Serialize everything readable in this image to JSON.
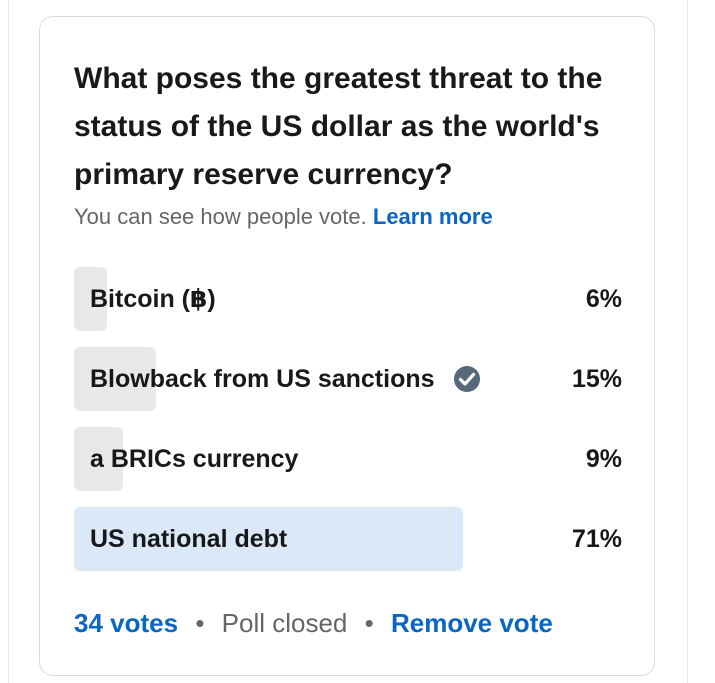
{
  "poll": {
    "question": "What poses the greatest threat to the status of the US dollar as the world's primary reserve currency?",
    "visibility_note": "You can see how people vote.",
    "learn_more": "Learn more",
    "options": [
      {
        "label": "Bitcoin (฿)",
        "percent_label": "6%",
        "percent": 6,
        "selected": false,
        "leading": false
      },
      {
        "label": "Blowback from US sanctions",
        "percent_label": "15%",
        "percent": 15,
        "selected": true,
        "leading": false
      },
      {
        "label": "a BRICs currency",
        "percent_label": "9%",
        "percent": 9,
        "selected": false,
        "leading": false
      },
      {
        "label": "US national debt",
        "percent_label": "71%",
        "percent": 71,
        "selected": false,
        "leading": true
      }
    ],
    "votes": "34 votes",
    "separator": "•",
    "status": "Poll closed",
    "remove_vote": "Remove vote",
    "selected_icon": "check-circle-icon"
  },
  "colors": {
    "accent": "#0a66c2",
    "bar": "#e8e8e8",
    "leading_bar": "#dbe8f8",
    "check_fill": "#56687a"
  }
}
